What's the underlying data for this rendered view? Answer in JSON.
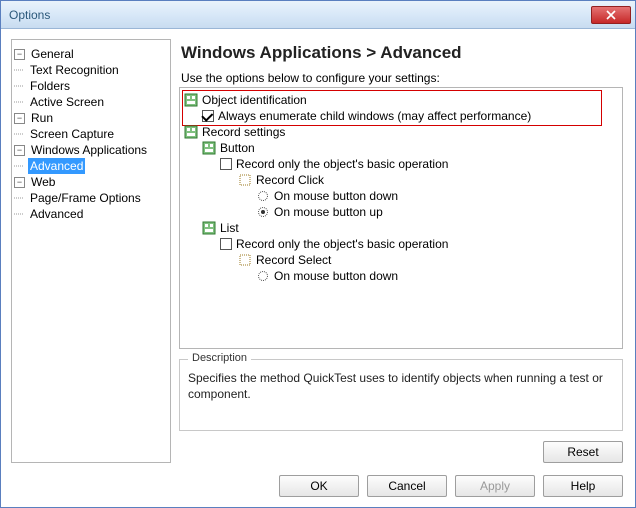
{
  "window": {
    "title": "Options"
  },
  "nav": {
    "items": [
      {
        "label": "General",
        "children": [
          {
            "label": "Text Recognition"
          },
          {
            "label": "Folders"
          },
          {
            "label": "Active Screen"
          }
        ]
      },
      {
        "label": "Run",
        "children": [
          {
            "label": "Screen Capture"
          }
        ]
      },
      {
        "label": "Windows Applications",
        "children": [
          {
            "label": "Advanced",
            "selected": true
          }
        ]
      },
      {
        "label": "Web",
        "children": [
          {
            "label": "Page/Frame Options"
          },
          {
            "label": "Advanced"
          }
        ]
      }
    ]
  },
  "main": {
    "heading": "Windows Applications > Advanced",
    "subtext": "Use the options below to configure your settings:",
    "settings": {
      "object_identification": {
        "label": "Object identification",
        "always_enumerate": {
          "label": "Always enumerate child windows (may affect performance)",
          "checked": true
        }
      },
      "record_settings": {
        "label": "Record settings",
        "button": {
          "label": "Button",
          "record_basic": {
            "label": "Record only the object's basic operation",
            "checked": false
          },
          "record_click": {
            "label": "Record Click",
            "on_down": "On mouse button down",
            "on_up": "On mouse button up"
          }
        },
        "list": {
          "label": "List",
          "record_basic": {
            "label": "Record only the object's basic operation",
            "checked": false
          },
          "record_select": {
            "label": "Record Select",
            "on_down": "On mouse button down"
          }
        }
      }
    },
    "description": {
      "legend": "Description",
      "text": "Specifies the method QuickTest uses to identify objects when running a test or component."
    },
    "reset_label": "Reset"
  },
  "buttons": {
    "ok": "OK",
    "cancel": "Cancel",
    "apply": "Apply",
    "help": "Help"
  }
}
